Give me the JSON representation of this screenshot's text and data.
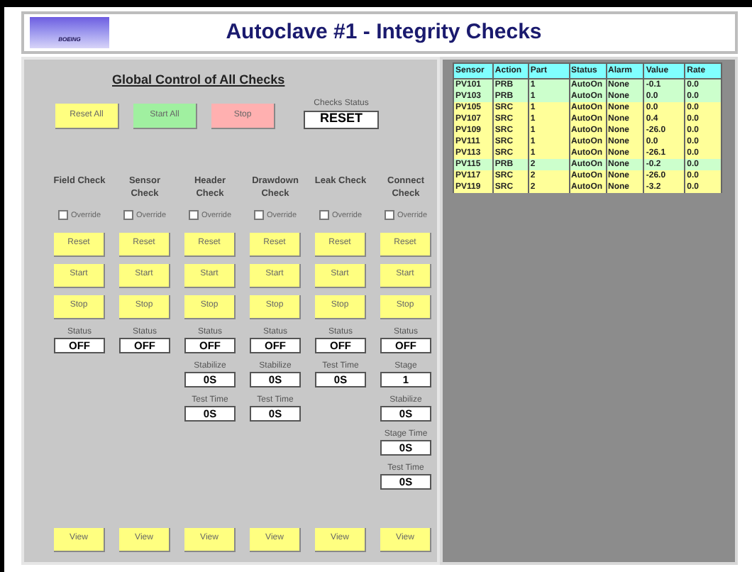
{
  "header": {
    "logo": "BOEING",
    "title": "Autoclave #1 - Integrity Checks"
  },
  "global": {
    "title": "Global Control of All Checks",
    "buttons": [
      {
        "label": "Reset All",
        "kind": "reset"
      },
      {
        "label": "Start All",
        "kind": "start"
      },
      {
        "label": "Stop",
        "kind": "stop"
      }
    ],
    "status_label": "Checks Status",
    "status_value": "RESET"
  },
  "checks": [
    {
      "name": "Field Check",
      "override_label": "Override",
      "override": false,
      "buttons": [
        "Reset",
        "Start",
        "Stop"
      ],
      "fields": [
        {
          "label": "Status",
          "value": "OFF"
        }
      ],
      "view": "View"
    },
    {
      "name": "Sensor Check",
      "override_label": "Override",
      "override": false,
      "buttons": [
        "Reset",
        "Start",
        "Stop"
      ],
      "fields": [
        {
          "label": "Status",
          "value": "OFF"
        }
      ],
      "view": "View"
    },
    {
      "name": "Header Check",
      "override_label": "Override",
      "override": false,
      "buttons": [
        "Reset",
        "Start",
        "Stop"
      ],
      "fields": [
        {
          "label": "Status",
          "value": "OFF"
        },
        {
          "label": "Stabilize",
          "value": "0S"
        },
        {
          "label": "Test Time",
          "value": "0S"
        }
      ],
      "view": "View"
    },
    {
      "name": "Drawdown Check",
      "override_label": "Override",
      "override": false,
      "buttons": [
        "Reset",
        "Start",
        "Stop"
      ],
      "fields": [
        {
          "label": "Status",
          "value": "OFF"
        },
        {
          "label": "Stabilize",
          "value": "0S"
        },
        {
          "label": "Test Time",
          "value": "0S"
        }
      ],
      "view": "View"
    },
    {
      "name": "Leak Check",
      "override_label": "Override",
      "override": false,
      "buttons": [
        "Reset",
        "Start",
        "Stop"
      ],
      "fields": [
        {
          "label": "Status",
          "value": "OFF"
        },
        {
          "label": "Test Time",
          "value": "0S"
        }
      ],
      "view": "View"
    },
    {
      "name": "Connect Check",
      "override_label": "Override",
      "override": false,
      "buttons": [
        "Reset",
        "Start",
        "Stop"
      ],
      "fields": [
        {
          "label": "Status",
          "value": "OFF"
        },
        {
          "label": "Stage",
          "value": "1"
        },
        {
          "label": "Stabilize",
          "value": "0S"
        },
        {
          "label": "Stage Time",
          "value": "0S"
        },
        {
          "label": "Test Time",
          "value": "0S"
        }
      ],
      "view": "View"
    }
  ],
  "table": {
    "columns": [
      "Sensor",
      "Action",
      "Part",
      "Status",
      "Alarm",
      "Value",
      "Rate"
    ],
    "rows": [
      {
        "color": "#ccffcc",
        "cells": [
          "PV101",
          "PRB",
          "1",
          "AutoOn",
          "None",
          "-0.1",
          "0.0"
        ]
      },
      {
        "color": "#ccffcc",
        "cells": [
          "PV103",
          "PRB",
          "1",
          "AutoOn",
          "None",
          "0.0",
          "0.0"
        ]
      },
      {
        "color": "#ffff99",
        "cells": [
          "PV105",
          "SRC",
          "1",
          "AutoOn",
          "None",
          "0.0",
          "0.0"
        ]
      },
      {
        "color": "#ffff99",
        "cells": [
          "PV107",
          "SRC",
          "1",
          "AutoOn",
          "None",
          "0.4",
          "0.0"
        ]
      },
      {
        "color": "#ffff99",
        "cells": [
          "PV109",
          "SRC",
          "1",
          "AutoOn",
          "None",
          "-26.0",
          "0.0"
        ]
      },
      {
        "color": "#ffff99",
        "cells": [
          "PV111",
          "SRC",
          "1",
          "AutoOn",
          "None",
          "0.0",
          "0.0"
        ]
      },
      {
        "color": "#ffff99",
        "cells": [
          "PV113",
          "SRC",
          "1",
          "AutoOn",
          "None",
          "-26.1",
          "0.0"
        ]
      },
      {
        "color": "#ccffcc",
        "cells": [
          "PV115",
          "PRB",
          "2",
          "AutoOn",
          "None",
          "-0.2",
          "0.0"
        ]
      },
      {
        "color": "#ffff99",
        "cells": [
          "PV117",
          "SRC",
          "2",
          "AutoOn",
          "None",
          "-26.0",
          "0.0"
        ]
      },
      {
        "color": "#ffff99",
        "cells": [
          "PV119",
          "SRC",
          "2",
          "AutoOn",
          "None",
          "-3.2",
          "0.0"
        ]
      }
    ]
  }
}
